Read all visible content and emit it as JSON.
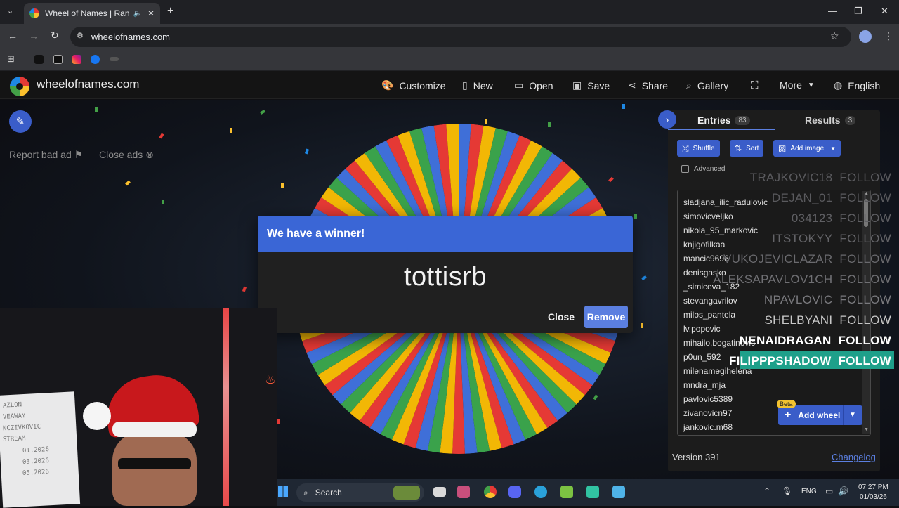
{
  "browser": {
    "tab_title": "Wheel of Names | Random",
    "url": "wheelofnames.com",
    "win_minimize": "—",
    "win_restore": "❐",
    "win_close": "✕"
  },
  "site": {
    "name": "wheelofnames.com",
    "nav": [
      "Customize",
      "New",
      "Open",
      "Save",
      "Share",
      "Gallery",
      "More",
      "English"
    ]
  },
  "ads": {
    "report": "Report bad ad",
    "close": "Close ads"
  },
  "dialog": {
    "header": "We have a winner!",
    "winner": "tottisrb",
    "close_label": "Close",
    "remove_label": "Remove"
  },
  "panel": {
    "entries_tab": "Entries",
    "entries_count": "83",
    "results_tab": "Results",
    "results_count": "3",
    "shuffle": "Shuffle",
    "sort": "Sort",
    "add_image": "Add image",
    "advanced": "Advanced",
    "entries": [
      "sladjana_ilic_radulovic",
      "simovicveljko",
      "nikola_95_markovic",
      "knjigofilkaa",
      "mancic9696",
      "denisgasko",
      "_simiceva_182",
      "stevangavrilov",
      "milos_pantela",
      "lv.popovic",
      "mihailo.bogatinovic",
      "p0un_592",
      "milenamegihelena",
      "mndra_mja",
      "pavlovic5389",
      "zivanovicn97",
      "jankovic.m68"
    ],
    "beta": "Beta",
    "add_wheel": "Add wheel",
    "version": "Version 391",
    "changelog": "Changelog"
  },
  "overlay": {
    "follows": [
      {
        "name": "TRAJKOVIC18",
        "action": "FOLLOW",
        "color": "#5a5a5e"
      },
      {
        "name": "DEJAN_01",
        "action": "FOLLOW",
        "color": "#5a5a5e"
      },
      {
        "name": "034123",
        "action": "FOLLOW",
        "color": "#5f5f63"
      },
      {
        "name": "ITSTOKYY",
        "action": "FOLLOW",
        "color": "#646468"
      },
      {
        "name": "VUKOJEVICLAZAR",
        "action": "FOLLOW",
        "color": "#6a6a6e"
      },
      {
        "name": "ALEKSAPAVLOV1CH",
        "action": "FOLLOW",
        "color": "#707074"
      },
      {
        "name": "NPAVLOVIC",
        "action": "FOLLOW",
        "color": "#7a7a7e"
      },
      {
        "name": "SHELBYANI",
        "action": "FOLLOW",
        "color": "#c8c8c8"
      },
      {
        "name": "NENAIDRAGAN",
        "action": "FOLLOW",
        "color": "#ffffff"
      },
      {
        "name": "FILIPPPSHADOW",
        "action": "FOLLOW",
        "color": "#ffffff"
      }
    ],
    "highlight_color": "#1ea08a"
  },
  "webcam": {
    "board_lines": [
      "AZLON",
      "VEAWAY",
      "NCZIVKOVIC",
      "STREAM",
      "01.2026",
      "03.2026",
      "05.2026"
    ]
  },
  "taskbar": {
    "search": "Search",
    "lang": "ENG",
    "time": "07:27 PM",
    "date": "01/03/26"
  },
  "colors": {
    "accent": "#3a5dc9",
    "dialog_header": "#3a66d6",
    "wheel": [
      "#3f6fd8",
      "#e53935",
      "#f2b705",
      "#3aa24b"
    ]
  }
}
